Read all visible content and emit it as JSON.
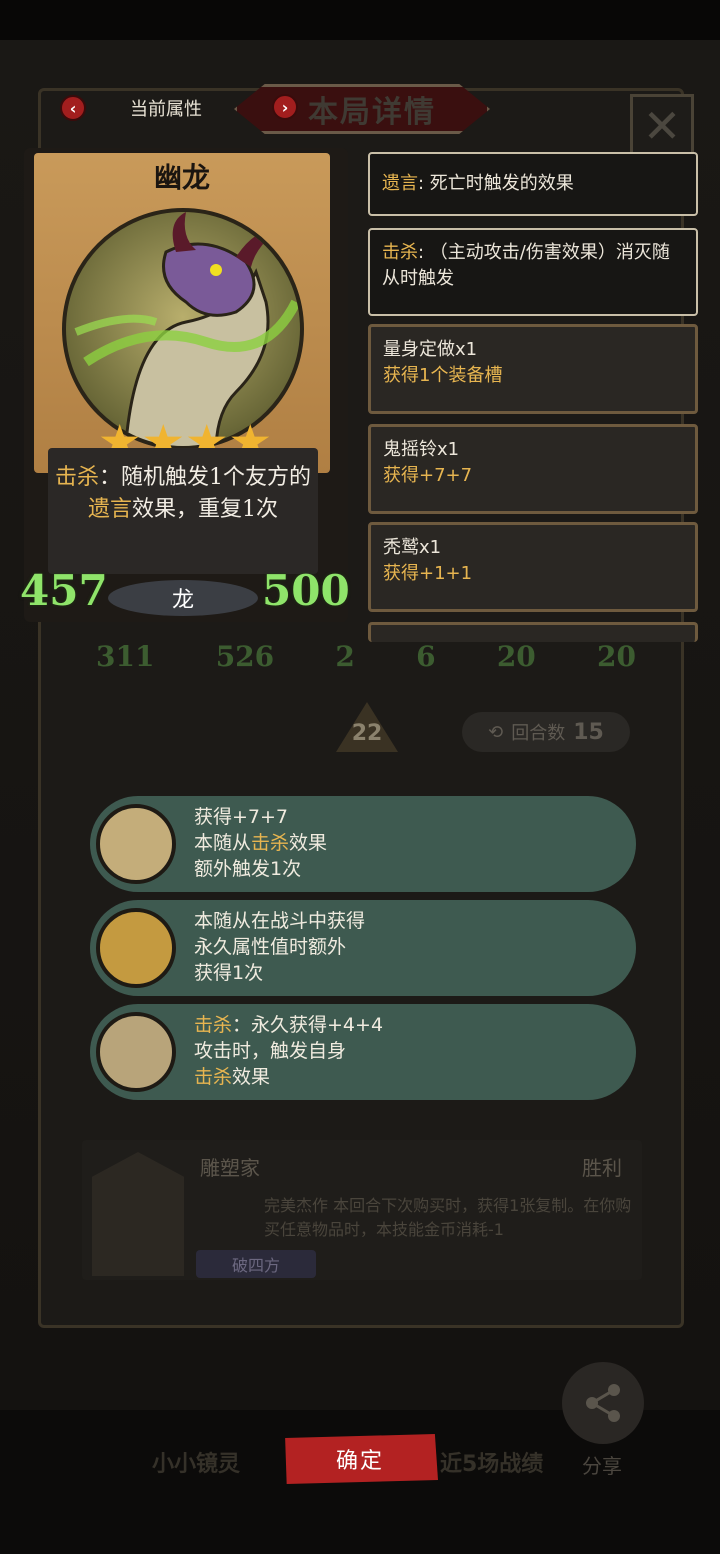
{
  "header": {
    "current_attr_tab": "当前属性",
    "detail_tab": "本局详情",
    "close_icon": "close-icon"
  },
  "card": {
    "name": "幽龙",
    "stars": 4,
    "desc_kw1": "击杀",
    "desc_part1": "：随机触发1个友方的",
    "desc_kw2": "遗言",
    "desc_part2": "效果，重复1次",
    "attack": "457",
    "health": "500",
    "tribe": "龙"
  },
  "keywords": [
    {
      "title": "遗言",
      "text": ": 死亡时触发的效果"
    },
    {
      "title": "击杀",
      "text": ": （主动攻击/伤害效果）消灭随从时触发"
    },
    {
      "title": "量身定做x1",
      "text": "获得1个装备槽"
    },
    {
      "title": "鬼摇铃x1",
      "text": "获得+7+7"
    },
    {
      "title": "秃鹫x1",
      "text": "获得+1+1"
    }
  ],
  "board": {
    "stats": [
      "311",
      "526",
      "2",
      "6",
      "20",
      "20"
    ],
    "turn_label": "回合数",
    "turn_value": "15",
    "level": "22"
  },
  "items": [
    {
      "line1": "获得+7+7",
      "line2_a": "本随从",
      "line2_kw": "击杀",
      "line2_b": "效果",
      "line3": "额外触发1次"
    },
    {
      "line1": "本随从在战斗中获得",
      "line2": "永久属性值时额外",
      "line3": "获得1次"
    },
    {
      "line1_kw": "击杀",
      "line1": "：永久获得+4+4",
      "line2": "攻击时，触发自身",
      "line3_kw": "击杀",
      "line3": "效果"
    }
  ],
  "hero": {
    "name": "雕塑家",
    "result": "胜利",
    "skill_name": "完美杰作",
    "skill_desc": "本回合下次购买时，获得1张复制。在你购买任意物品时，本技能金币消耗-1",
    "tag": "破四方"
  },
  "footer": {
    "left": "小小镜灵",
    "confirm": "确定",
    "right": "近5场战绩",
    "share": "分享"
  },
  "colors": {
    "keyword": "#e7b550",
    "stat_green": "#8fe46a",
    "confirm_red": "#b32222",
    "tooltip_teal": "#3e5a50"
  }
}
